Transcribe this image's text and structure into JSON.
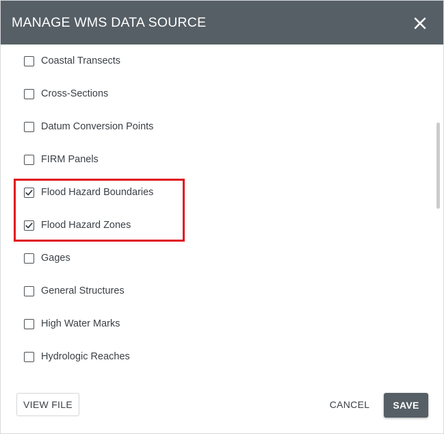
{
  "dialog": {
    "title": "MANAGE WMS DATA SOURCE",
    "close_icon": "close-icon"
  },
  "layers": [
    {
      "label": "Coastal Transects",
      "checked": false
    },
    {
      "label": "Cross-Sections",
      "checked": false
    },
    {
      "label": "Datum Conversion Points",
      "checked": false
    },
    {
      "label": "FIRM Panels",
      "checked": false
    },
    {
      "label": "Flood Hazard Boundaries",
      "checked": true
    },
    {
      "label": "Flood Hazard Zones",
      "checked": true
    },
    {
      "label": "Gages",
      "checked": false
    },
    {
      "label": "General Structures",
      "checked": false
    },
    {
      "label": "High Water Marks",
      "checked": false
    },
    {
      "label": "Hydrologic Reaches",
      "checked": false
    }
  ],
  "footer": {
    "view_file_label": "VIEW FILE",
    "cancel_label": "CANCEL",
    "save_label": "SAVE"
  },
  "colors": {
    "header_bg": "#565f66",
    "highlight": "#e0101a",
    "save_bg": "#565f66"
  }
}
